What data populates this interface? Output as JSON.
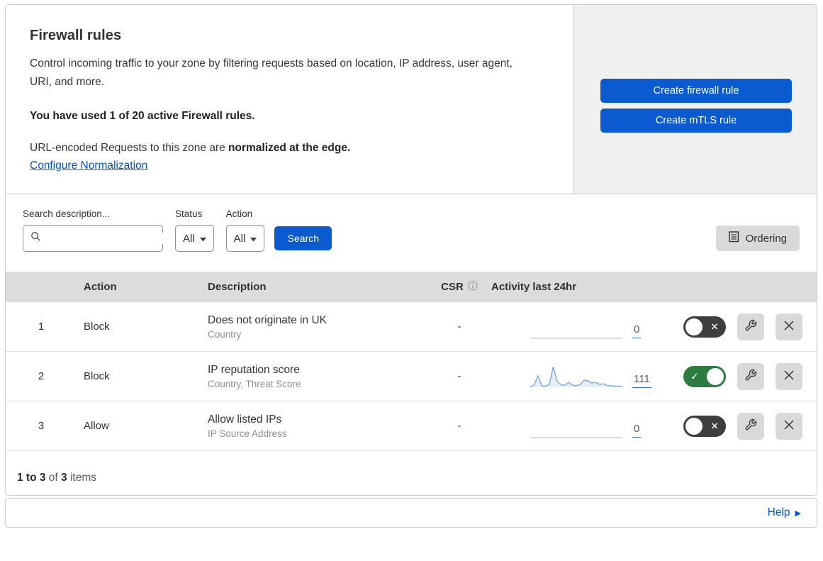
{
  "header": {
    "title": "Firewall rules",
    "description": "Control incoming traffic to your zone by filtering requests based on location, IP address, user agent, URI, and more.",
    "usage": "You have used 1 of 20 active Firewall rules.",
    "normalization_prefix": "URL-encoded Requests to this zone are ",
    "normalization_bold": "normalized at the edge.",
    "normalization_link": "Configure Normalization",
    "create_firewall_rule": "Create firewall rule",
    "create_mtls_rule": "Create mTLS rule"
  },
  "filters": {
    "search_label": "Search description...",
    "search_placeholder": "",
    "search_value": "",
    "status_label": "Status",
    "status_value": "All",
    "action_label": "Action",
    "action_value": "All",
    "search_button": "Search",
    "ordering_button": "Ordering"
  },
  "table": {
    "columns": {
      "action": "Action",
      "description": "Description",
      "csr": "CSR",
      "activity": "Activity last 24hr"
    },
    "rows": [
      {
        "num": "1",
        "action": "Block",
        "description": "Does not originate in UK",
        "fields": "Country",
        "csr": "-",
        "activity_total": "0",
        "activity_values": [
          0,
          0,
          0,
          0,
          0,
          0,
          0,
          0,
          0,
          0,
          0,
          0,
          0,
          0,
          0,
          0,
          0,
          0,
          0,
          0,
          0,
          0,
          0,
          0
        ],
        "enabled": false
      },
      {
        "num": "2",
        "action": "Block",
        "description": "IP reputation score",
        "fields": "Country, Threat Score",
        "csr": "-",
        "activity_total": "111",
        "activity_values": [
          3,
          10,
          55,
          8,
          5,
          14,
          100,
          28,
          12,
          9,
          24,
          10,
          8,
          12,
          34,
          32,
          20,
          24,
          14,
          17,
          9,
          7,
          6,
          5,
          4
        ],
        "enabled": true
      },
      {
        "num": "3",
        "action": "Allow",
        "description": "Allow listed IPs",
        "fields": "IP Source Address",
        "csr": "-",
        "activity_total": "0",
        "activity_values": [
          0,
          0,
          0,
          0,
          0,
          0,
          0,
          0,
          0,
          0,
          0,
          0,
          0,
          0,
          0,
          0,
          0,
          0,
          0,
          0,
          0,
          0,
          0,
          0
        ],
        "enabled": false
      }
    ],
    "summary": {
      "range": "1 to 3",
      "of": " of ",
      "total": "3",
      "items": " items"
    }
  },
  "footer": {
    "help": "Help"
  },
  "colors": {
    "primary_blue": "#0b5bd0",
    "link_blue": "#0055cc",
    "toggle_on_green": "#2c7b41",
    "toggle_off_gray": "#3e3e3e",
    "spark_blue": "#74a7e8",
    "panel_gray": "#f0f0f0",
    "table_header_gray": "#dcdcdc"
  }
}
